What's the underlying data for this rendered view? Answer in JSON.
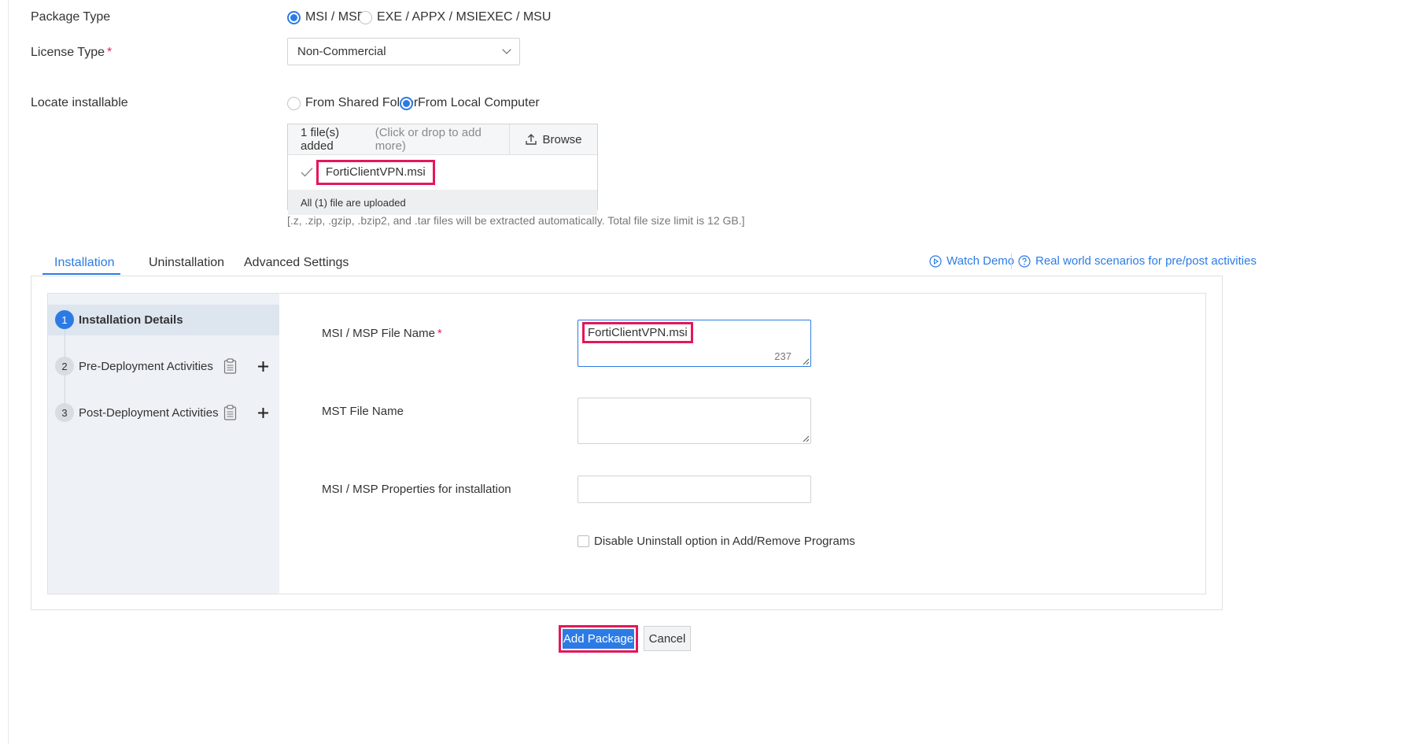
{
  "form": {
    "package_type": {
      "label": "Package Type",
      "options": [
        {
          "label": "MSI / MSP",
          "selected": true
        },
        {
          "label": "EXE / APPX / MSIEXEC / MSU",
          "selected": false
        }
      ]
    },
    "license_type": {
      "label": "License Type",
      "required_mark": "*",
      "value": "Non-Commercial"
    },
    "locate_installable": {
      "label": "Locate installable",
      "options": [
        {
          "label": "From Shared Folder",
          "selected": false
        },
        {
          "label": "From Local Computer",
          "selected": true
        }
      ]
    },
    "upload": {
      "count_text": "1 file(s) added",
      "hint_text": "(Click or drop to add more)",
      "browse_label": "Browse",
      "file_name": "FortiClientVPN.msi",
      "status_text": "All (1) file are uploaded",
      "note": "[.z, .zip, .gzip, .bzip2, and .tar files will be extracted automatically. Total file size limit is 12 GB.]"
    }
  },
  "tabs": [
    {
      "label": "Installation",
      "active": true
    },
    {
      "label": "Uninstallation",
      "active": false
    },
    {
      "label": "Advanced Settings",
      "active": false
    }
  ],
  "links": {
    "watch_demo": "Watch Demo",
    "scenarios": "Real world scenarios for pre/post activities"
  },
  "steps": [
    {
      "num": "1",
      "label": "Installation Details",
      "active": true
    },
    {
      "num": "2",
      "label": "Pre-Deployment Activities",
      "active": false
    },
    {
      "num": "3",
      "label": "Post-Deployment Activities",
      "active": false
    }
  ],
  "details": {
    "msi_file_name": {
      "label": "MSI / MSP File Name",
      "required_mark": "*",
      "value": "FortiClientVPN.msi",
      "char_count": "237"
    },
    "mst_file_name": {
      "label": "MST File Name",
      "value": ""
    },
    "msi_properties": {
      "label": "MSI / MSP Properties for installation",
      "value": ""
    },
    "disable_uninstall": {
      "label": "Disable Uninstall option in Add/Remove Programs",
      "checked": false
    }
  },
  "footer": {
    "add_label": "Add Package",
    "cancel_label": "Cancel"
  },
  "colors": {
    "accent": "#2c7be5",
    "highlight": "#e5165a"
  }
}
